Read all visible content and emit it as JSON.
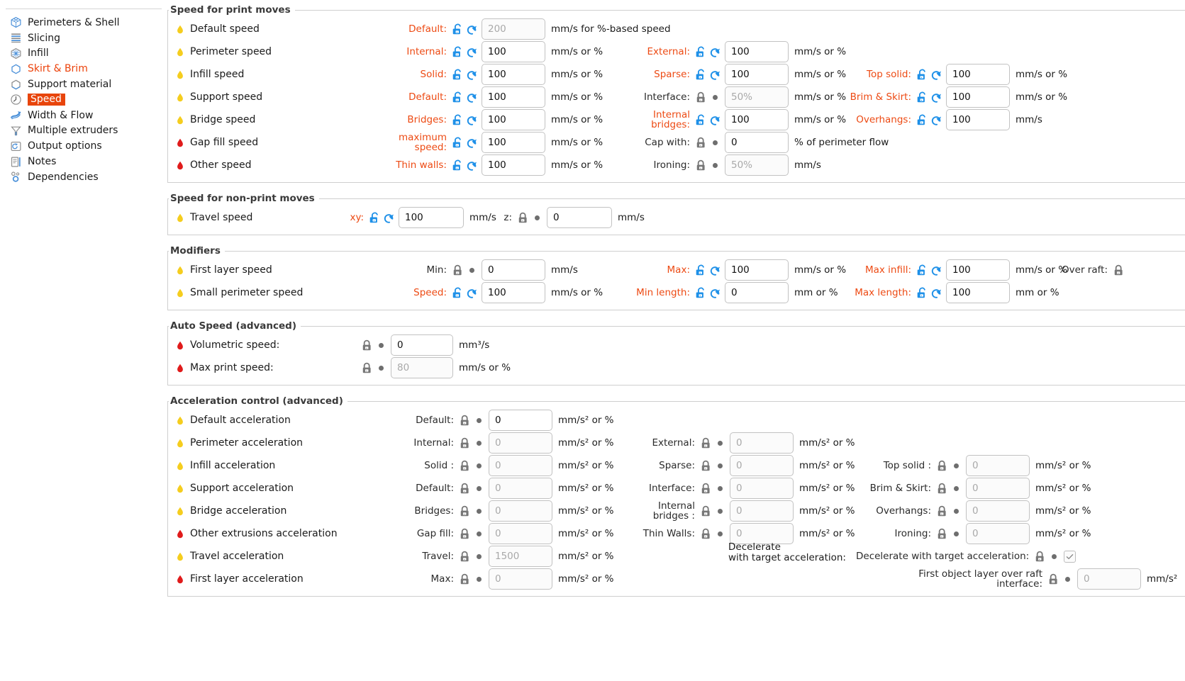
{
  "sidebar": {
    "items": [
      {
        "label": "Perimeters & Shell",
        "icon": "perimeters-icon",
        "state": "normal"
      },
      {
        "label": "Slicing",
        "icon": "slicing-icon",
        "state": "normal"
      },
      {
        "label": "Infill",
        "icon": "infill-icon",
        "state": "normal"
      },
      {
        "label": "Skirt & Brim",
        "icon": "skirt-brim-icon",
        "state": "modified"
      },
      {
        "label": "Support material",
        "icon": "support-material-icon",
        "state": "normal"
      },
      {
        "label": "Speed",
        "icon": "speed-icon",
        "state": "selected"
      },
      {
        "label": "Width & Flow",
        "icon": "width-flow-icon",
        "state": "normal"
      },
      {
        "label": "Multiple extruders",
        "icon": "multiple-extruders-icon",
        "state": "normal"
      },
      {
        "label": "Output options",
        "icon": "output-options-icon",
        "state": "normal"
      },
      {
        "label": "Notes",
        "icon": "notes-icon",
        "state": "normal"
      },
      {
        "label": "Dependencies",
        "icon": "dependencies-icon",
        "state": "normal"
      }
    ]
  },
  "colors": {
    "accent_orange": "#ed4a13",
    "selected_bg": "#e8450c",
    "bullet_yellow": "#f5cd1e",
    "bullet_red": "#e01b1b",
    "icon_blue": "#1e90e8",
    "icon_gray": "#777777"
  },
  "groups": {
    "print_moves": {
      "title": "Speed for print moves",
      "rows": [
        {
          "name": "Default speed",
          "bullet": "yellow",
          "fields": [
            {
              "label": "Default:",
              "label_color": "orange",
              "lock": "unlocked-blue",
              "reset": "reset-blue",
              "value": "",
              "placeholder": "200",
              "unit": "mm/s for %-based speed"
            }
          ]
        },
        {
          "name": "Perimeter speed",
          "bullet": "yellow",
          "fields": [
            {
              "label": "Internal:",
              "label_color": "orange",
              "lock": "unlocked-blue",
              "reset": "reset-blue",
              "value": "100",
              "placeholder": "",
              "unit": "mm/s or %"
            },
            {
              "label": "External:",
              "label_color": "orange",
              "lock": "unlocked-blue",
              "reset": "reset-blue",
              "value": "100",
              "placeholder": "",
              "unit": "mm/s or %"
            }
          ]
        },
        {
          "name": "Infill speed",
          "bullet": "yellow",
          "fields": [
            {
              "label": "Solid:",
              "label_color": "orange",
              "lock": "unlocked-blue",
              "reset": "reset-blue",
              "value": "100",
              "placeholder": "",
              "unit": "mm/s or %"
            },
            {
              "label": "Sparse:",
              "label_color": "orange",
              "lock": "unlocked-blue",
              "reset": "reset-blue",
              "value": "100",
              "placeholder": "",
              "unit": "mm/s or %"
            },
            {
              "label": "Top solid:",
              "label_color": "orange",
              "lock": "unlocked-blue",
              "reset": "reset-blue",
              "value": "100",
              "placeholder": "",
              "unit": "mm/s or %"
            }
          ]
        },
        {
          "name": "Support speed",
          "bullet": "yellow",
          "fields": [
            {
              "label": "Default:",
              "label_color": "orange",
              "lock": "unlocked-blue",
              "reset": "reset-blue",
              "value": "100",
              "placeholder": "",
              "unit": "mm/s or %"
            },
            {
              "label": "Interface:",
              "label_color": "gray",
              "lock": "locked-gray",
              "reset": "dot-gray",
              "value": "",
              "placeholder": "50%",
              "unit": "mm/s or %"
            },
            {
              "label": "Brim & Skirt:",
              "label_color": "orange",
              "lock": "unlocked-blue",
              "reset": "reset-blue",
              "value": "100",
              "placeholder": "",
              "unit": "mm/s or %"
            }
          ]
        },
        {
          "name": "Bridge speed",
          "bullet": "yellow",
          "fields": [
            {
              "label": "Bridges:",
              "label_color": "orange",
              "lock": "unlocked-blue",
              "reset": "reset-blue",
              "value": "100",
              "placeholder": "",
              "unit": "mm/s or %"
            },
            {
              "label": "Internal bridges:",
              "label_color": "orange",
              "lock": "unlocked-blue",
              "reset": "reset-blue",
              "value": "100",
              "placeholder": "",
              "unit": "mm/s or %"
            },
            {
              "label": "Overhangs:",
              "label_color": "orange",
              "lock": "unlocked-blue",
              "reset": "reset-blue",
              "value": "100",
              "placeholder": "",
              "unit": "mm/s"
            }
          ]
        },
        {
          "name": "Gap fill speed",
          "bullet": "red",
          "fields": [
            {
              "label": "maximum speed:",
              "label_color": "orange",
              "lock": "unlocked-blue",
              "reset": "reset-blue",
              "value": "100",
              "placeholder": "",
              "unit": "mm/s or %"
            },
            {
              "label": "Cap with:",
              "label_color": "gray",
              "lock": "locked-gray",
              "reset": "dot-gray",
              "value": "0",
              "placeholder": "",
              "unit": "% of perimeter flow"
            }
          ]
        },
        {
          "name": "Other speed",
          "bullet": "red",
          "fields": [
            {
              "label": "Thin walls:",
              "label_color": "orange",
              "lock": "unlocked-blue",
              "reset": "reset-blue",
              "value": "100",
              "placeholder": "",
              "unit": "mm/s or %"
            },
            {
              "label": "Ironing:",
              "label_color": "gray",
              "lock": "locked-gray",
              "reset": "dot-gray",
              "value": "",
              "placeholder": "50%",
              "unit": "mm/s"
            }
          ]
        }
      ]
    },
    "non_print_moves": {
      "title": "Speed for non-print moves",
      "rows": [
        {
          "name": "Travel speed",
          "bullet": "yellow",
          "fields": [
            {
              "label": "xy:",
              "label_color": "orange",
              "lock": "unlocked-blue",
              "reset": "reset-blue",
              "value": "100",
              "placeholder": "",
              "unit": "mm/s"
            },
            {
              "label": "z:",
              "label_color": "gray",
              "lock": "locked-gray",
              "reset": "dot-gray",
              "value": "0",
              "placeholder": "",
              "unit": "mm/s"
            }
          ]
        }
      ]
    },
    "modifiers": {
      "title": "Modifiers",
      "rows": [
        {
          "name": "First layer speed",
          "bullet": "yellow",
          "fields": [
            {
              "label": "Min:",
              "label_color": "gray",
              "lock": "locked-gray",
              "reset": "dot-gray",
              "value": "0",
              "placeholder": "",
              "unit": "mm/s"
            },
            {
              "label": "Max:",
              "label_color": "orange",
              "lock": "unlocked-blue",
              "reset": "reset-blue",
              "value": "100",
              "placeholder": "",
              "unit": "mm/s or %"
            },
            {
              "label": "Max infill:",
              "label_color": "orange",
              "lock": "unlocked-blue",
              "reset": "reset-blue",
              "value": "100",
              "placeholder": "",
              "unit": "mm/s or %"
            },
            {
              "label": "Over raft:",
              "label_color": "gray",
              "lock": "locked-gray",
              "reset": "",
              "value": "",
              "placeholder": "",
              "unit": ""
            }
          ]
        },
        {
          "name": "Small perimeter speed",
          "bullet": "yellow",
          "fields": [
            {
              "label": "Speed:",
              "label_color": "orange",
              "lock": "unlocked-blue",
              "reset": "reset-blue",
              "value": "100",
              "placeholder": "",
              "unit": "mm/s or %"
            },
            {
              "label": "Min length:",
              "label_color": "orange",
              "lock": "unlocked-blue",
              "reset": "reset-blue",
              "value": "0",
              "placeholder": "",
              "unit": "mm or %"
            },
            {
              "label": "Max length:",
              "label_color": "orange",
              "lock": "unlocked-blue",
              "reset": "reset-blue",
              "value": "100",
              "placeholder": "",
              "unit": "mm or %"
            }
          ]
        }
      ]
    },
    "auto_speed": {
      "title": "Auto Speed (advanced)",
      "rows": [
        {
          "name": "Volumetric speed:",
          "bullet": "red",
          "fields": [
            {
              "label": "",
              "label_color": "gray",
              "lock": "locked-gray",
              "reset": "dot-gray",
              "value": "0",
              "placeholder": "",
              "unit": "mm³/s"
            }
          ]
        },
        {
          "name": "Max print speed:",
          "bullet": "red",
          "fields": [
            {
              "label": "",
              "label_color": "gray",
              "lock": "locked-gray",
              "reset": "dot-gray",
              "value": "",
              "placeholder": "80",
              "unit": "mm/s or %"
            }
          ]
        }
      ]
    },
    "acceleration": {
      "title": "Acceleration control (advanced)",
      "rows": [
        {
          "name": "Default acceleration",
          "bullet": "yellow",
          "fields": [
            {
              "label": "Default:",
              "label_color": "gray",
              "lock": "locked-gray",
              "reset": "dot-gray",
              "value": "0",
              "placeholder": "",
              "unit": "mm/s² or %"
            }
          ]
        },
        {
          "name": "Perimeter acceleration",
          "bullet": "yellow",
          "fields": [
            {
              "label": "Internal:",
              "label_color": "gray",
              "lock": "locked-gray",
              "reset": "dot-gray",
              "value": "",
              "placeholder": "0",
              "unit": "mm/s² or %"
            },
            {
              "label": "External:",
              "label_color": "gray",
              "lock": "locked-gray",
              "reset": "dot-gray",
              "value": "",
              "placeholder": "0",
              "unit": "mm/s² or %"
            }
          ]
        },
        {
          "name": "Infill acceleration",
          "bullet": "yellow",
          "fields": [
            {
              "label": "Solid :",
              "label_color": "gray",
              "lock": "locked-gray",
              "reset": "dot-gray",
              "value": "",
              "placeholder": "0",
              "unit": "mm/s² or %"
            },
            {
              "label": "Sparse:",
              "label_color": "gray",
              "lock": "locked-gray",
              "reset": "dot-gray",
              "value": "",
              "placeholder": "0",
              "unit": "mm/s² or %"
            },
            {
              "label": "Top solid :",
              "label_color": "gray",
              "lock": "locked-gray",
              "reset": "dot-gray",
              "value": "",
              "placeholder": "0",
              "unit": "mm/s² or %"
            }
          ]
        },
        {
          "name": "Support acceleration",
          "bullet": "yellow",
          "fields": [
            {
              "label": "Default:",
              "label_color": "gray",
              "lock": "locked-gray",
              "reset": "dot-gray",
              "value": "",
              "placeholder": "0",
              "unit": "mm/s² or %"
            },
            {
              "label": "Interface:",
              "label_color": "gray",
              "lock": "locked-gray",
              "reset": "dot-gray",
              "value": "",
              "placeholder": "0",
              "unit": "mm/s² or %"
            },
            {
              "label": "Brim & Skirt:",
              "label_color": "gray",
              "lock": "locked-gray",
              "reset": "dot-gray",
              "value": "",
              "placeholder": "0",
              "unit": "mm/s² or %"
            }
          ]
        },
        {
          "name": "Bridge acceleration",
          "bullet": "yellow",
          "fields": [
            {
              "label": "Bridges:",
              "label_color": "gray",
              "lock": "locked-gray",
              "reset": "dot-gray",
              "value": "",
              "placeholder": "0",
              "unit": "mm/s² or %"
            },
            {
              "label": "Internal bridges :",
              "label_color": "gray",
              "lock": "locked-gray",
              "reset": "dot-gray",
              "value": "",
              "placeholder": "0",
              "unit": "mm/s² or %"
            },
            {
              "label": "Overhangs:",
              "label_color": "gray",
              "lock": "locked-gray",
              "reset": "dot-gray",
              "value": "",
              "placeholder": "0",
              "unit": "mm/s² or %"
            }
          ]
        },
        {
          "name": "Other extrusions acceleration",
          "bullet": "red",
          "fields": [
            {
              "label": "Gap fill:",
              "label_color": "gray",
              "lock": "locked-gray",
              "reset": "dot-gray",
              "value": "",
              "placeholder": "0",
              "unit": "mm/s² or %"
            },
            {
              "label": "Thin Walls:",
              "label_color": "gray",
              "lock": "locked-gray",
              "reset": "dot-gray",
              "value": "",
              "placeholder": "0",
              "unit": "mm/s² or %"
            },
            {
              "label": "Ironing:",
              "label_color": "gray",
              "lock": "locked-gray",
              "reset": "dot-gray",
              "value": "",
              "placeholder": "0",
              "unit": "mm/s² or %"
            }
          ]
        },
        {
          "name": "Travel acceleration",
          "bullet": "yellow",
          "fields": [
            {
              "label": "Travel:",
              "label_color": "gray",
              "lock": "locked-gray",
              "reset": "dot-gray",
              "value": "",
              "placeholder": "1500",
              "unit": "mm/s² or %"
            },
            {
              "label": "Decelerate with target acceleration:",
              "label_color": "gray",
              "lock": "locked-gray",
              "reset": "dot-gray",
              "value": "checked",
              "placeholder": "",
              "unit": ""
            }
          ]
        },
        {
          "name": "First layer acceleration",
          "bullet": "red",
          "fields": [
            {
              "label": "Max:",
              "label_color": "gray",
              "lock": "locked-gray",
              "reset": "dot-gray",
              "value": "",
              "placeholder": "0",
              "unit": "mm/s² or %"
            },
            {
              "label": "First object layer over raft interface:",
              "label_color": "gray",
              "lock": "locked-gray",
              "reset": "dot-gray",
              "value": "",
              "placeholder": "0",
              "unit": "mm/s²"
            }
          ]
        }
      ]
    }
  },
  "overlap_labels": {
    "decelerate_line1": "Decelerate",
    "decelerate_line2": "with target acceleration:"
  }
}
